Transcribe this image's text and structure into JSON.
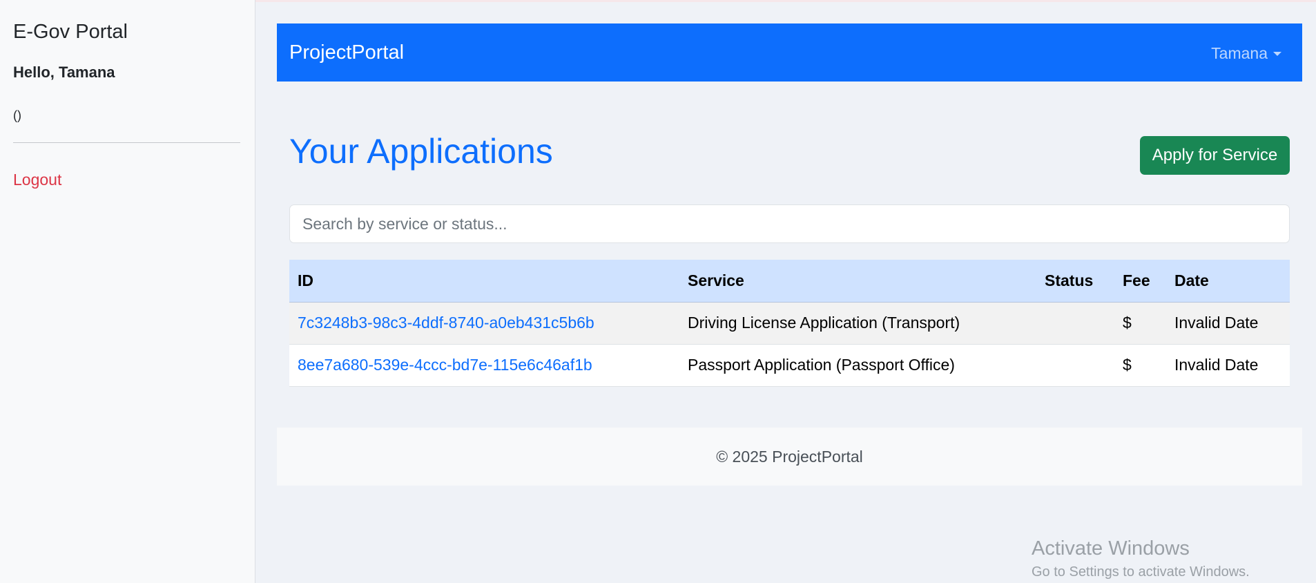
{
  "sidebar": {
    "title": "E-Gov Portal",
    "greeting": "Hello, Tamana",
    "subinfo": "()",
    "logout_label": "Logout"
  },
  "navbar": {
    "brand": "ProjectPortal",
    "user": "Tamana"
  },
  "main": {
    "title": "Your Applications",
    "apply_label": "Apply for Service",
    "search_placeholder": "Search by service or status...",
    "table": {
      "headers": [
        "ID",
        "Service",
        "Status",
        "Fee",
        "Date"
      ],
      "rows": [
        {
          "id": "7c3248b3-98c3-4ddf-8740-a0eb431c5b6b",
          "service": "Driving License Application (Transport)",
          "status": "",
          "fee": "$",
          "date": "Invalid Date"
        },
        {
          "id": "8ee7a680-539e-4ccc-bd7e-115e6c46af1b",
          "service": "Passport Application (Passport Office)",
          "status": "",
          "fee": "$",
          "date": "Invalid Date"
        }
      ]
    }
  },
  "footer": {
    "text": "© 2025 ProjectPortal"
  },
  "watermark": {
    "line1": "Activate Windows",
    "line2": "Go to Settings to activate Windows."
  },
  "colors": {
    "primary": "#0d6efd",
    "success": "#198754",
    "danger": "#dc3545",
    "table_header": "#cfe2ff"
  }
}
